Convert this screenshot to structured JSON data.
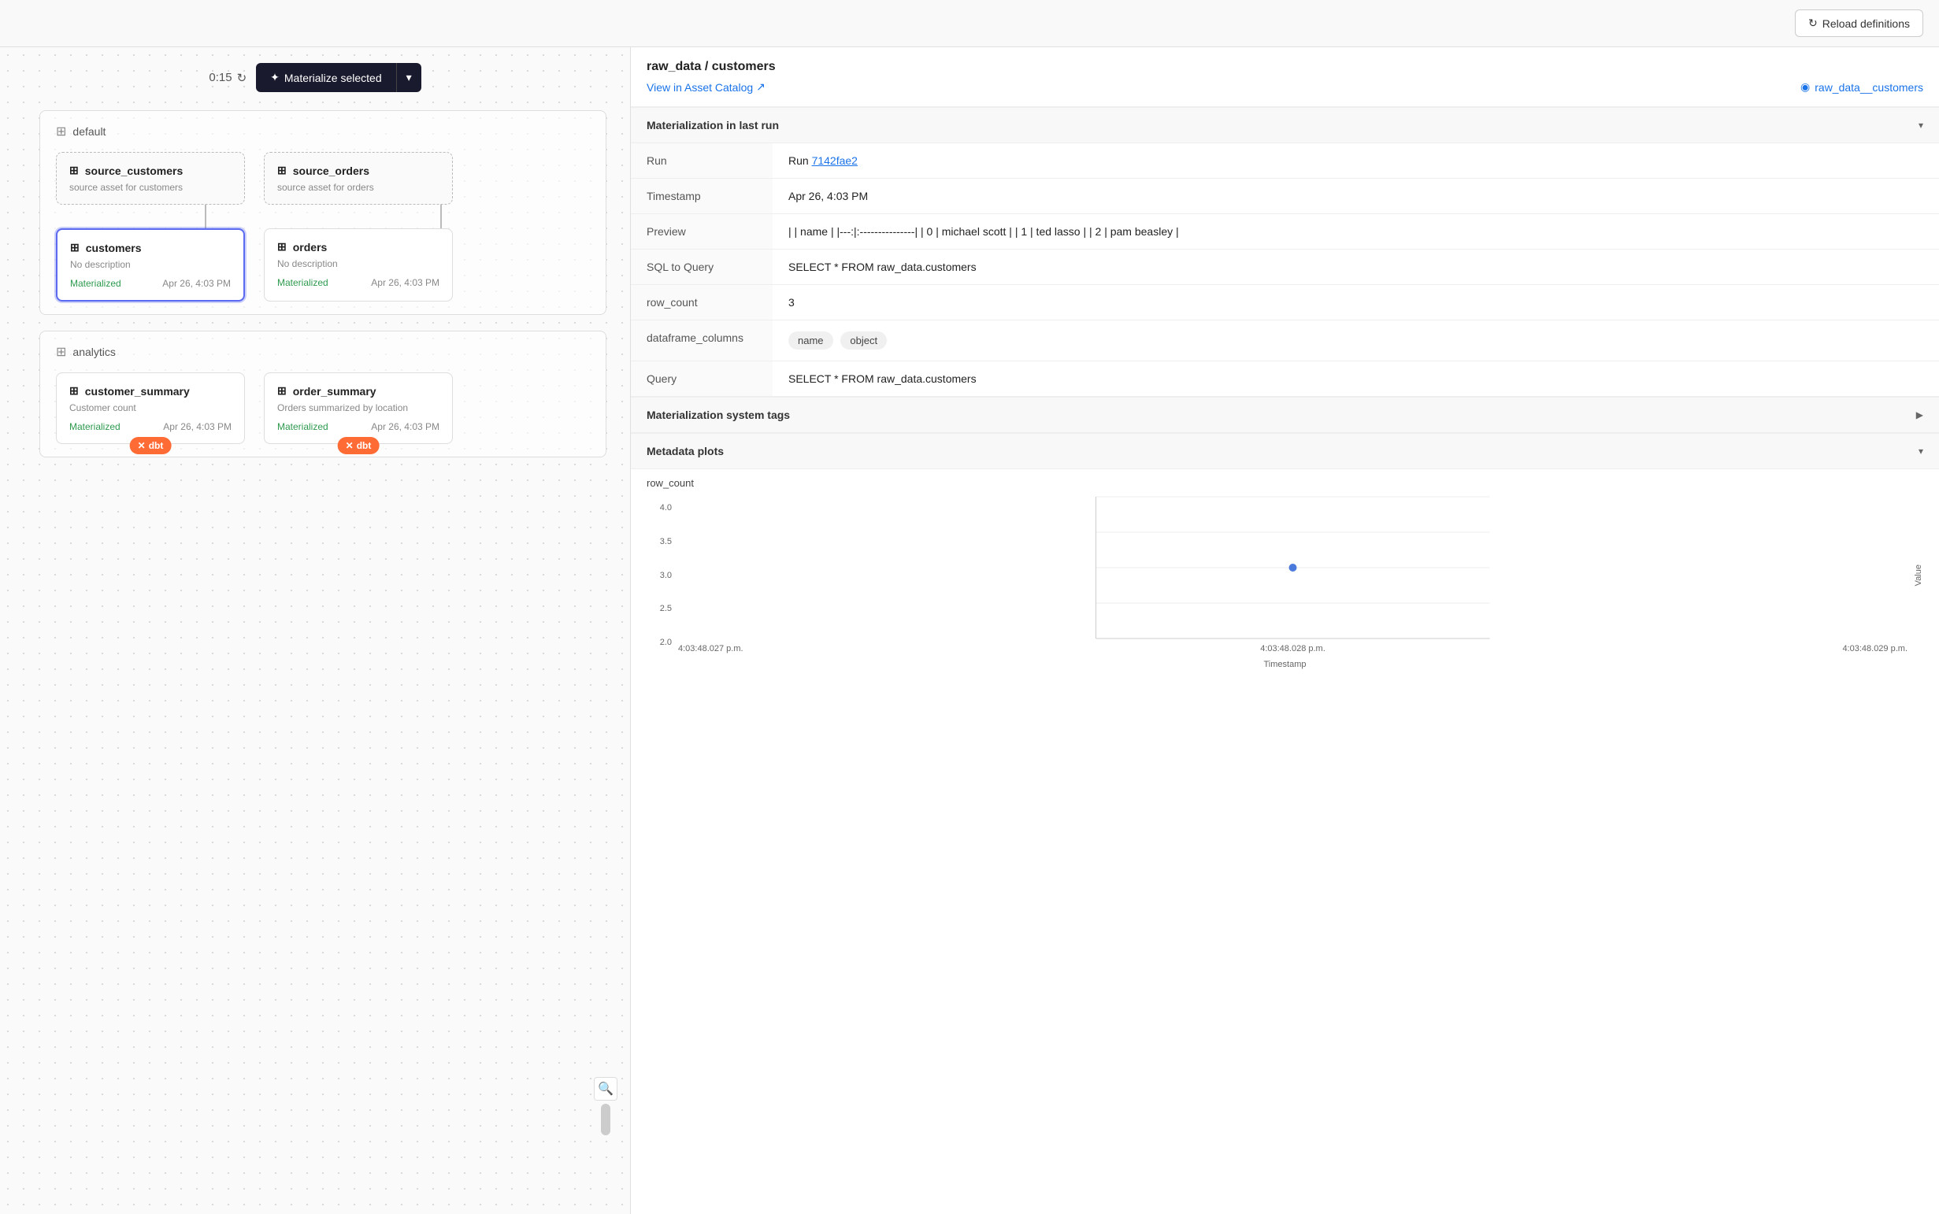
{
  "topbar": {
    "reload_label": "Reload definitions",
    "reload_icon": "↻"
  },
  "toolbar": {
    "timer": "0:15",
    "timer_icon": "↻",
    "materialize_label": "Materialize selected",
    "materialize_icon": "✦"
  },
  "graph": {
    "groups": [
      {
        "id": "default",
        "label": "default",
        "source_nodes": [
          {
            "id": "source_customers",
            "label": "source_customers",
            "desc": "source asset for customers"
          },
          {
            "id": "source_orders",
            "label": "source_orders",
            "desc": "source asset for orders"
          }
        ],
        "nodes": [
          {
            "id": "customers",
            "label": "customers",
            "desc": "No description",
            "status": "Materialized",
            "timestamp": "Apr 26, 4:03 PM",
            "selected": true
          },
          {
            "id": "orders",
            "label": "orders",
            "desc": "No description",
            "status": "Materialized",
            "timestamp": "Apr 26, 4:03 PM",
            "selected": false
          }
        ]
      },
      {
        "id": "analytics",
        "label": "analytics",
        "nodes": [
          {
            "id": "customer_summary",
            "label": "customer_summary",
            "desc": "Customer count",
            "status": "Materialized",
            "timestamp": "Apr 26, 4:03 PM",
            "dbt": true,
            "selected": false
          },
          {
            "id": "order_summary",
            "label": "order_summary",
            "desc": "Orders summarized by location",
            "status": "Materialized",
            "timestamp": "Apr 26, 4:03 PM",
            "dbt": true,
            "selected": false
          }
        ]
      }
    ]
  },
  "detail_panel": {
    "breadcrumb": "raw_data / customers",
    "view_link": "View in Asset Catalog",
    "asset_tag": "raw_data__customers",
    "asset_tag_icon": "◉",
    "sections": {
      "materialization": {
        "title": "Materialization in last run",
        "expanded": true,
        "rows": [
          {
            "label": "Run",
            "value": "Run ",
            "link": "7142fae2",
            "link_text": "7142fae2"
          },
          {
            "label": "Timestamp",
            "value": "Apr 26, 4:03 PM"
          },
          {
            "label": "Preview",
            "value": "| | name | |---:|:---------------| | 0 | michael scott | | 1 | ted lasso | | 2 | pam beasley |"
          },
          {
            "label": "SQL to Query",
            "value": "SELECT * FROM raw_data.customers"
          },
          {
            "label": "row_count",
            "value": "3"
          },
          {
            "label": "dataframe_columns",
            "tags": [
              "name",
              "object"
            ]
          },
          {
            "label": "Query",
            "value": "SELECT * FROM raw_data.customers"
          }
        ]
      },
      "system_tags": {
        "title": "Materialization system tags",
        "expanded": false
      },
      "metadata_plots": {
        "title": "Metadata plots",
        "expanded": true
      }
    },
    "chart": {
      "title": "row_count",
      "y_label": "Value",
      "x_label": "Timestamp",
      "y_ticks": [
        "4.0",
        "3.5",
        "3.0",
        "2.5",
        "2.0"
      ],
      "x_ticks": [
        "4:03:48.027 p.m.",
        "4:03:48.028 p.m.",
        "4:03:48.029 p.m."
      ],
      "data_point": {
        "x": "4:03:48.028 p.m.",
        "y": 3,
        "y_pct": 0.5
      }
    }
  }
}
